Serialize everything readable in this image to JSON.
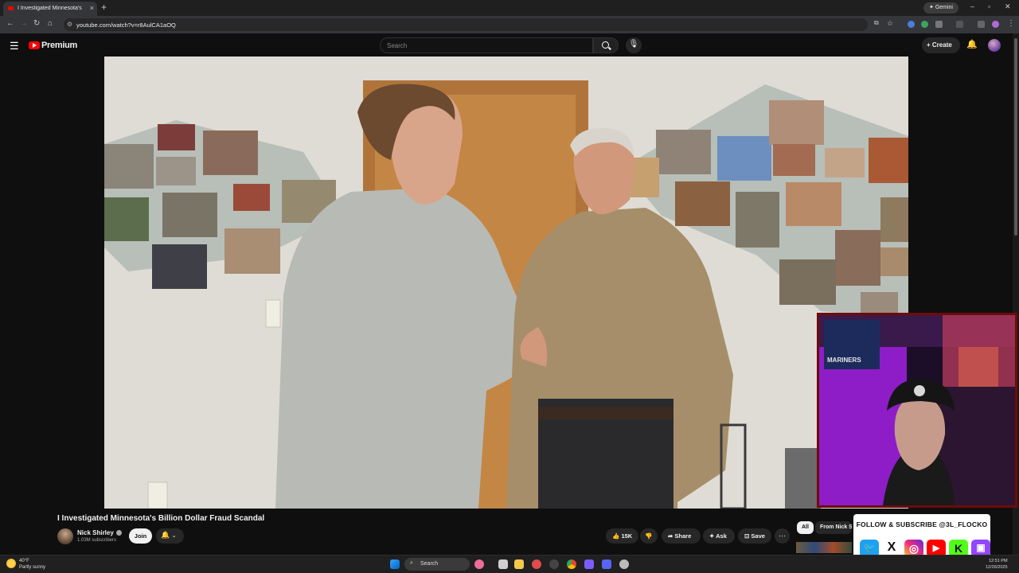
{
  "browser": {
    "tab_title": "I Investigated Minnesota's",
    "url": "youtube.com/watch?v=r8AulCA1aOQ",
    "gemini_label": "Gemini"
  },
  "youtube": {
    "brand": "Premium",
    "search_placeholder": "Search",
    "create_label": "Create"
  },
  "video": {
    "title": "I Investigated Minnesota's Billion Dollar Fraud Scandal",
    "channel_name": "Nick Shirley",
    "subscribers": "1.03M subscribers",
    "join_label": "Join",
    "likes": "15K",
    "share_label": "Share",
    "ask_label": "Ask",
    "save_label": "Save"
  },
  "recommendations": {
    "chips": [
      "All",
      "From Nick S"
    ]
  },
  "overlay": {
    "follow_text": "FOLLOW & SUBSCRIBE @3L_FLOCKO",
    "cap_text": "MARINERS",
    "socials": [
      {
        "name": "twitter",
        "glyph": "🐦",
        "color": "#1da1f2"
      },
      {
        "name": "x",
        "glyph": "X",
        "color": "#111111"
      },
      {
        "name": "instagram",
        "glyph": "◎",
        "color": "#d6249f"
      },
      {
        "name": "youtube",
        "glyph": "▶",
        "color": "#ff0000"
      },
      {
        "name": "kick",
        "glyph": "K",
        "color": "#53fc18"
      },
      {
        "name": "twitch",
        "glyph": "▣",
        "color": "#9146ff"
      }
    ]
  },
  "taskbar": {
    "temperature": "40°F",
    "weather": "Partly sunny",
    "search_label": "Search",
    "time": "12:51 PM",
    "date": "12/26/2025"
  }
}
